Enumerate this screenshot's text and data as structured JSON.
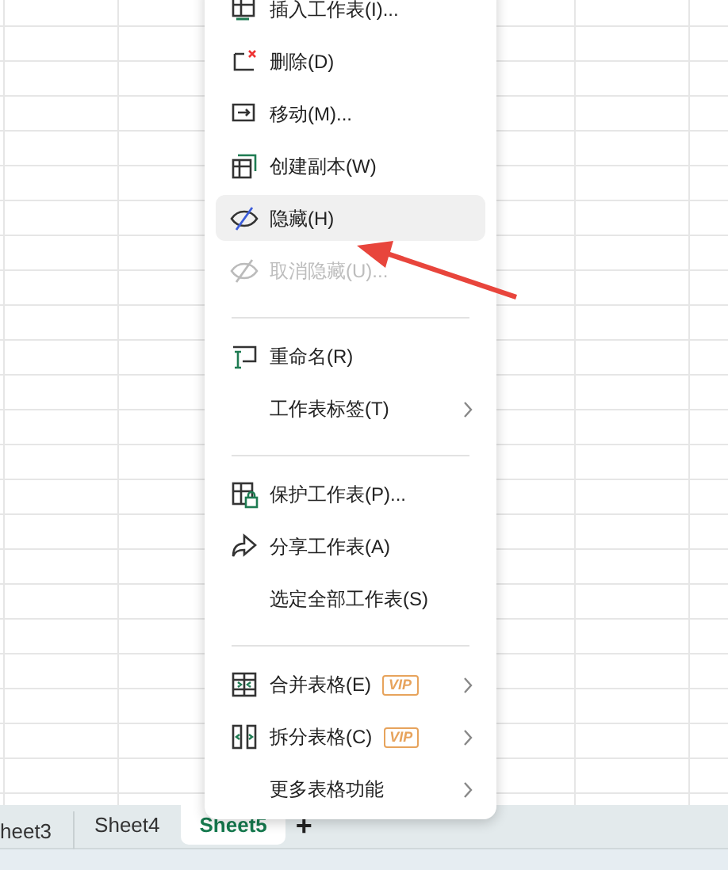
{
  "menu": {
    "items": [
      {
        "kind": "item",
        "label": "插入工作表(I)...",
        "disabled": false,
        "highlighted": false,
        "vip": false,
        "submenu": false
      },
      {
        "kind": "item",
        "label": "删除(D)",
        "disabled": false,
        "highlighted": false,
        "vip": false,
        "submenu": false
      },
      {
        "kind": "item",
        "label": "移动(M)...",
        "disabled": false,
        "highlighted": false,
        "vip": false,
        "submenu": false
      },
      {
        "kind": "item",
        "label": "创建副本(W)",
        "disabled": false,
        "highlighted": false,
        "vip": false,
        "submenu": false
      },
      {
        "kind": "item",
        "label": "隐藏(H)",
        "disabled": false,
        "highlighted": true,
        "vip": false,
        "submenu": false
      },
      {
        "kind": "item",
        "label": "取消隐藏(U)...",
        "disabled": true,
        "highlighted": false,
        "vip": false,
        "submenu": false
      },
      {
        "kind": "divider"
      },
      {
        "kind": "item",
        "label": "重命名(R)",
        "disabled": false,
        "highlighted": false,
        "vip": false,
        "submenu": false
      },
      {
        "kind": "item",
        "label": "工作表标签(T)",
        "disabled": false,
        "highlighted": false,
        "vip": false,
        "submenu": true
      },
      {
        "kind": "divider"
      },
      {
        "kind": "item",
        "label": "保护工作表(P)...",
        "disabled": false,
        "highlighted": false,
        "vip": false,
        "submenu": false
      },
      {
        "kind": "item",
        "label": "分享工作表(A)",
        "disabled": false,
        "highlighted": false,
        "vip": false,
        "submenu": false
      },
      {
        "kind": "item",
        "label": "选定全部工作表(S)",
        "disabled": false,
        "highlighted": false,
        "vip": false,
        "submenu": false
      },
      {
        "kind": "divider"
      },
      {
        "kind": "item",
        "label": "合并表格(E)",
        "disabled": false,
        "highlighted": false,
        "vip": true,
        "vip_label": "VIP",
        "submenu": true
      },
      {
        "kind": "item",
        "label": "拆分表格(C)",
        "disabled": false,
        "highlighted": false,
        "vip": true,
        "vip_label": "VIP",
        "submenu": true
      },
      {
        "kind": "item",
        "label": "更多表格功能",
        "disabled": false,
        "highlighted": false,
        "vip": false,
        "submenu": true
      }
    ]
  },
  "sheet_tabs": [
    {
      "label": "heet3",
      "selected": false
    },
    {
      "label": "Sheet4",
      "selected": false
    },
    {
      "label": "Sheet5",
      "selected": true
    }
  ],
  "add_sheet_button": "+"
}
